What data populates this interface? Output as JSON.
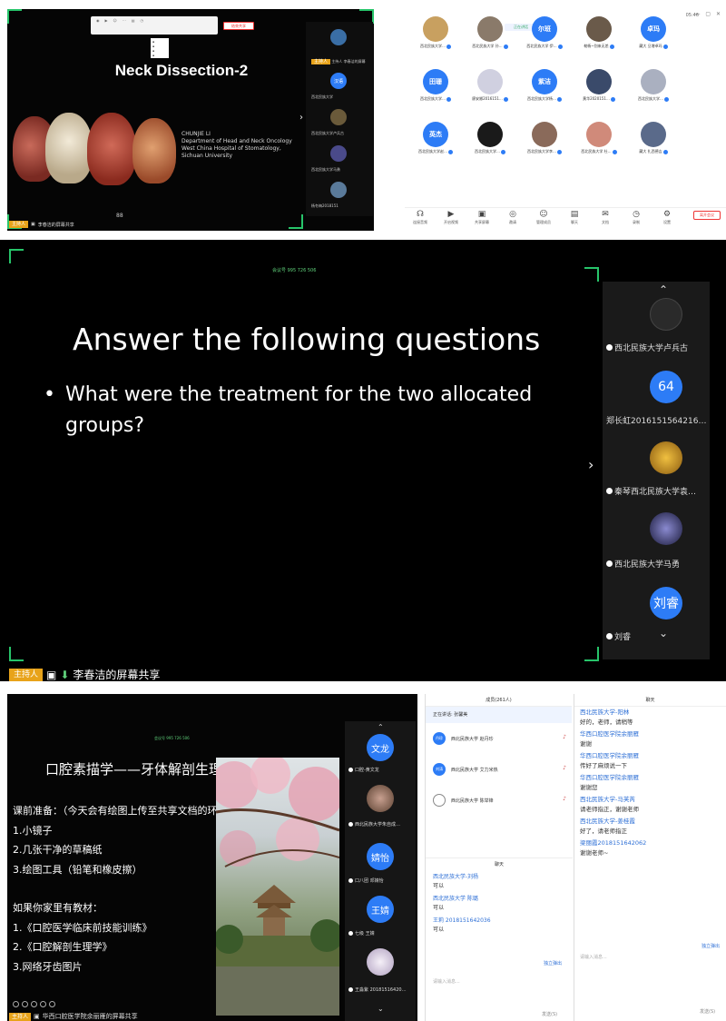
{
  "panel1": {
    "slide_title": "Neck Dissection-2",
    "author_lines": [
      "CHUNJIE LI",
      "Department of Head and Neck Oncology",
      "West China Hospital of Stomatology,",
      "Sichuan University"
    ],
    "page_mark": "88",
    "toolbar_stop": "结束共享",
    "host_tag": "主持人",
    "share_status": "李春洁的屏幕共享",
    "speaking": "正在讲话",
    "time": "05:46",
    "end_meeting": "离开会议",
    "strip_tiles": [
      {
        "label": "主持人 李春洁的屏幕",
        "avatar": "",
        "color": "#3a6ea5"
      },
      {
        "label": "西北民族大学",
        "avatar": "汉语",
        "color": "#2d7cf6"
      },
      {
        "label": "西北民族大学卢兵古",
        "avatar": "",
        "color": "#6a5a3a"
      },
      {
        "label": "西北民族大学马勇",
        "avatar": "",
        "color": "#4a4a8a"
      },
      {
        "label": "杨冬梅2018151",
        "avatar": "",
        "color": "#5a7a9a"
      }
    ],
    "grid": [
      {
        "name": "西北民族大学…",
        "avatar": "",
        "color": "#c8a060"
      },
      {
        "name": "西北民族大学 孙…",
        "avatar": "",
        "color": "#8a7a6a"
      },
      {
        "name": "西北民族大学 伊…",
        "avatar": "尔班",
        "color": "#2d7cf6"
      },
      {
        "name": "勒杨~别来无恙",
        "avatar": "",
        "color": "#6a5a4a"
      },
      {
        "name": "藏大 旦增卓玛",
        "avatar": "卓玛",
        "color": "#2d7cf6"
      },
      {
        "name": "西北民族大学…",
        "avatar": "田珊",
        "color": "#2d7cf6"
      },
      {
        "name": "廖安娜2016151…",
        "avatar": "",
        "color": "#d0d0e0"
      },
      {
        "name": "西北民族大学杨…",
        "avatar": "紫洁",
        "color": "#2d7cf6"
      },
      {
        "name": "黄华2020151…",
        "avatar": "",
        "color": "#3a4a6a"
      },
      {
        "name": "西北民族大学…",
        "avatar": "",
        "color": "#aab0c0"
      },
      {
        "name": "西北民族大学赵…",
        "avatar": "英杰",
        "color": "#2d7cf6"
      },
      {
        "name": "西北民族大学…",
        "avatar": "",
        "color": "#1a1a1a"
      },
      {
        "name": "西北民族大学李…",
        "avatar": "",
        "color": "#8a6a5a"
      },
      {
        "name": "西北民族大学 杜…",
        "avatar": "",
        "color": "#d08a7a"
      },
      {
        "name": "藏大 扎西德吉",
        "avatar": "",
        "color": "#5a6a8a"
      }
    ],
    "footer_buttons": [
      {
        "icon": "☊",
        "label": "连接音频"
      },
      {
        "icon": "▶",
        "label": "开启视频"
      },
      {
        "icon": "▣",
        "label": "共享屏幕"
      },
      {
        "icon": "◎",
        "label": "邀请"
      },
      {
        "icon": "☺",
        "label": "管理成员"
      },
      {
        "icon": "▤",
        "label": "聊天"
      },
      {
        "icon": "✉",
        "label": "文档"
      },
      {
        "icon": "◷",
        "label": "录制"
      },
      {
        "icon": "⚙",
        "label": "设置"
      }
    ]
  },
  "panel2": {
    "meeting_id": "会议号 995 726 506",
    "title": "Answer the following questions",
    "bullet": "What were the treatment for the two allocated groups?",
    "host_tag": "主持人",
    "share_status": "李春洁的屏幕共享",
    "tiles": [
      {
        "label": "西北民族大学卢兵古",
        "avatar": "",
        "color": "#2a2a2a"
      },
      {
        "label": "郑长虹2016151564216…",
        "avatar": "64",
        "color": "#2d7cf6"
      },
      {
        "label": "秦琴西北民族大学袁…",
        "avatar": "",
        "color": "#c8a020"
      },
      {
        "label": "西北民族大学马勇",
        "avatar": "",
        "color": "#2a2a5a"
      },
      {
        "label": "刘睿",
        "avatar": "刘睿",
        "color": "#2d7cf6"
      }
    ]
  },
  "panel3": {
    "meeting_id": "会议号 995 726 506",
    "title": "口腔素描学——牙体解剖生理",
    "lines": [
      "课前准备：（今天会有绘图上传至共享文档的环节）",
      "1.小镜子",
      "2.几张干净的草稿纸",
      "3.绘图工具（铅笔和橡皮擦）",
      "",
      "如果你家里有教材：",
      "1.《口腔医学临床前技能训练》",
      "2.《口腔解剖生理学》",
      "3.网络牙齿图片"
    ],
    "host_tag": "主持人",
    "share_status": "华西口腔医学院余丽雁的屏幕共享",
    "tiles": [
      {
        "label": "口腔-黄文龙",
        "avatar": "文龙",
        "color": "#2d7cf6"
      },
      {
        "label": "西北民族大学朱自成…",
        "avatar": "",
        "color": "#7a6a5a"
      },
      {
        "label": "口八团 邓婧怡",
        "avatar": "婧怡",
        "color": "#2d7cf6"
      },
      {
        "label": "七级 王婧",
        "avatar": "王婧",
        "color": "#2d7cf6"
      },
      {
        "label": "王淼紫 20181516420…",
        "avatar": "",
        "color": "#e0d8e8"
      }
    ],
    "members": {
      "title": "成员(261人)",
      "speaking": "正在讲话: 张馨美",
      "rows": [
        {
          "avatar": "丹珍",
          "name": "西北民族大学 赵丹珍"
        },
        {
          "avatar": "刘涛",
          "name": "西北民族大学 艾力米热"
        },
        {
          "avatar": "",
          "name": "西北民族大学 陈举锋"
        }
      ]
    },
    "chat_small": {
      "title": "聊天",
      "messages": [
        {
          "name": "西北民族大学-刘杨",
          "text": "可以"
        },
        {
          "name": "西北民族大学 陈璐",
          "text": "可以"
        },
        {
          "name": "王莉 2018151642036",
          "text": "可以"
        }
      ],
      "popout": "独立弹出",
      "input": "请输入消息...",
      "send": "发送(S)"
    },
    "chat": {
      "title": "聊天",
      "messages": [
        {
          "name": "西北民族大学-阳林",
          "text": "好的，老师，请稍等"
        },
        {
          "name": "华西口腔医学院余丽雁",
          "text": "谢谢"
        },
        {
          "name": "华西口腔医学院余丽雁",
          "text": "传好了麻烦说一下"
        },
        {
          "name": "华西口腔医学院余丽雁",
          "text": "谢谢您"
        },
        {
          "name": "西北民族大学-马芙芮",
          "text": "请老师指正，谢谢老师"
        },
        {
          "name": "西北民族大学-姜桂霞",
          "text": "好了，请老师指正"
        },
        {
          "name": "梁丽霞2018151642062",
          "text": "谢谢老师~"
        }
      ],
      "popout": "独立弹出",
      "input": "请输入消息...",
      "send": "发送(S)"
    }
  }
}
